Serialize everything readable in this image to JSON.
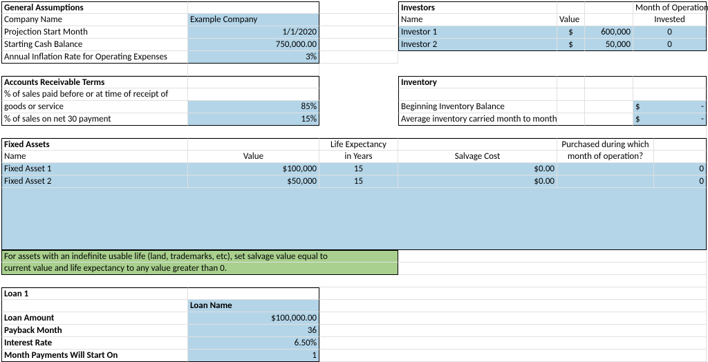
{
  "general": {
    "header": "General Assumptions",
    "rows": {
      "company_label": "Company Name",
      "company_value": "Example Company",
      "start_label": "Projection Start Month",
      "start_value": "1/1/2020",
      "cash_label": "Starting Cash Balance",
      "cash_value": "750,000.00",
      "inflation_label": "Annual Inflation Rate for Operating Expenses",
      "inflation_value": "3%"
    }
  },
  "investors": {
    "header": "Investors",
    "name_hdr": "Name",
    "value_hdr": "Value",
    "month_hdr_line1": "Month of Operation",
    "month_hdr_line2": "Invested",
    "rows": [
      {
        "name": "Investor 1",
        "curr": "$",
        "value": "600,000",
        "month": "0"
      },
      {
        "name": "Investor 2",
        "curr": "$",
        "value": "50,000",
        "month": "0"
      }
    ]
  },
  "ar": {
    "header": "Accounts Receivable Terms",
    "r1_label_a": "% of sales paid before or at time of receipt of",
    "r1_label_b": "goods or service",
    "r1_value": "85%",
    "r2_label": "% of sales on net 30 payment",
    "r2_value": "15%"
  },
  "inventory": {
    "header": "Inventory",
    "row1_label": "Beginning Inventory Balance",
    "row2_label": "Average inventory carried month to month",
    "curr": "$",
    "dash": "-"
  },
  "fixed_assets": {
    "header": "Fixed Assets",
    "name_hdr": "Name",
    "value_hdr": "Value",
    "life_hdr_a": "Life Expectancy",
    "life_hdr_b": "in Years",
    "salvage_hdr": "Salvage Cost",
    "month_hdr_a": "Purchased during which",
    "month_hdr_b": "month of operation?",
    "rows": [
      {
        "name": "Fixed Asset 1",
        "value": "$100,000",
        "life": "15",
        "salvage": "$0.00",
        "month": "0"
      },
      {
        "name": "Fixed Asset 2",
        "value": "$50,000",
        "life": "15",
        "salvage": "$0.00",
        "month": "0"
      }
    ],
    "note_a": "For assets with an indefinite usable life (land, trademarks, etc), set salvage value equal to",
    "note_b": "current value and life expectancy to any value greater than 0."
  },
  "loan": {
    "header": "Loan 1",
    "name_hdr": "Loan Name",
    "amount_label": "Loan Amount",
    "amount_value": "$100,000.00",
    "payback_label": "Payback Month",
    "payback_value": "36",
    "rate_label": "Interest Rate",
    "rate_value": "6.50%",
    "start_label": "Month Payments Will Start On",
    "start_value": "1"
  }
}
